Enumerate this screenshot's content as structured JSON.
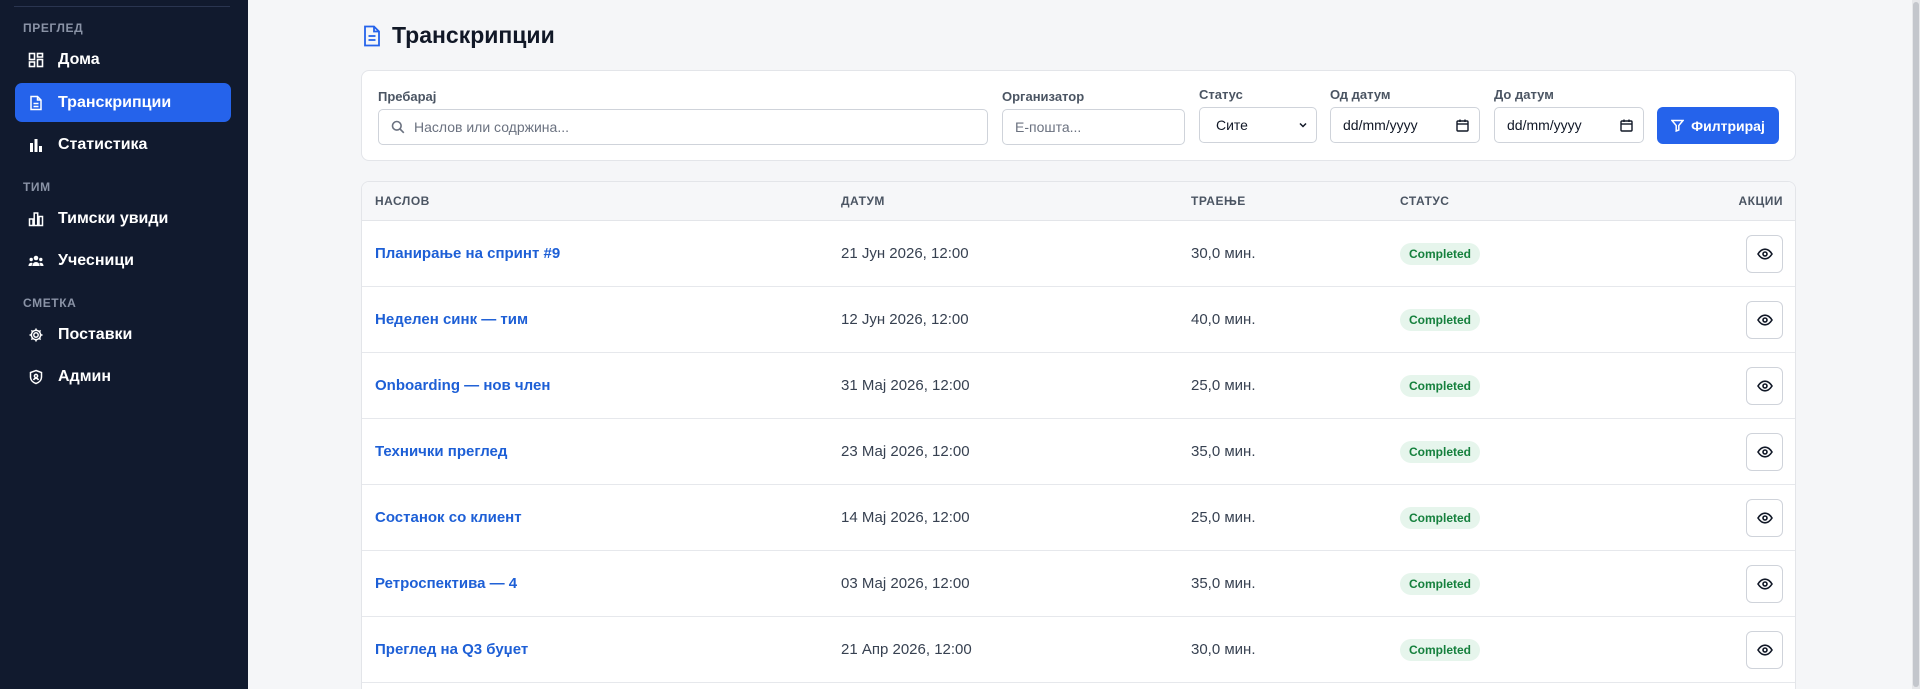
{
  "sidebar": {
    "sections": [
      {
        "label": "ПРЕГЛЕД"
      },
      {
        "label": "ТИМ"
      },
      {
        "label": "СМЕТКА"
      }
    ],
    "items": [
      {
        "label": "Дома",
        "icon": "dashboard-icon"
      },
      {
        "label": "Транскрипции",
        "icon": "document-icon",
        "active": true
      },
      {
        "label": "Статистика",
        "icon": "bar-chart-icon"
      },
      {
        "label": "Тимски увиди",
        "icon": "team-chart-icon"
      },
      {
        "label": "Учесници",
        "icon": "users-icon"
      },
      {
        "label": "Поставки",
        "icon": "gear-icon"
      },
      {
        "label": "Админ",
        "icon": "shield-icon"
      }
    ]
  },
  "page": {
    "title": "Транскрипции"
  },
  "filters": {
    "search_label": "Пребарај",
    "search_placeholder": "Наслов или содржина...",
    "organizer_label": "Организатор",
    "organizer_placeholder": "Е-пошта...",
    "status_label": "Статус",
    "status_value": "Сите",
    "from_label": "Од датум",
    "from_value": "dd/mm/yyyy",
    "to_label": "До датум",
    "to_value": "dd/mm/yyyy",
    "filter_button": "Филтрирај"
  },
  "table": {
    "headers": {
      "title": "НАСЛОВ",
      "date": "ДАТУМ",
      "duration": "ТРАЕЊЕ",
      "status": "СТАТУС",
      "actions": "АКЦИИ"
    },
    "rows": [
      {
        "title": "Планирање на спринт #9",
        "date": "21 Јун 2026, 12:00",
        "duration": "30,0 мин.",
        "status": "Completed"
      },
      {
        "title": "Неделен синк — тим",
        "date": "12 Јун 2026, 12:00",
        "duration": "40,0 мин.",
        "status": "Completed"
      },
      {
        "title": "Onboarding — нов член",
        "date": "31 Мај 2026, 12:00",
        "duration": "25,0 мин.",
        "status": "Completed"
      },
      {
        "title": "Технички преглед",
        "date": "23 Мај 2026, 12:00",
        "duration": "35,0 мин.",
        "status": "Completed"
      },
      {
        "title": "Состанок со клиент",
        "date": "14 Мај 2026, 12:00",
        "duration": "25,0 мин.",
        "status": "Completed"
      },
      {
        "title": "Ретроспектива — 4",
        "date": "03 Мај 2026, 12:00",
        "duration": "35,0 мин.",
        "status": "Completed"
      },
      {
        "title": "Преглед на Q3 буџет",
        "date": "21 Апр 2026, 12:00",
        "duration": "30,0 мин.",
        "status": "Completed"
      }
    ]
  },
  "colors": {
    "sidebar_bg": "#111a2e",
    "accent": "#2563eb",
    "link": "#1d5fd6",
    "badge_bg": "#e6f5ec",
    "badge_text": "#15803d"
  }
}
